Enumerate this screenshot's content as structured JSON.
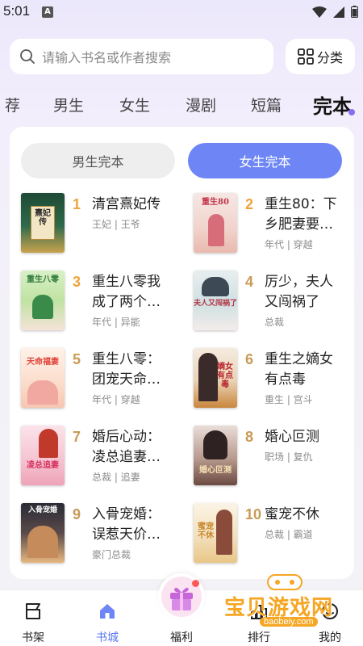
{
  "status_bar": {
    "time": "5:01",
    "badge": "A"
  },
  "search": {
    "placeholder": "请输入书名或作者搜索"
  },
  "category_button": {
    "label": "分类"
  },
  "tabs": [
    {
      "label": "荐"
    },
    {
      "label": "男生"
    },
    {
      "label": "女生"
    },
    {
      "label": "漫剧"
    },
    {
      "label": "短篇"
    },
    {
      "label": "完本",
      "active": true
    }
  ],
  "toggle": {
    "male_label": "男生完本",
    "female_label": "女生完本",
    "selected": "女生完本"
  },
  "books": [
    {
      "rank": "1",
      "title": "清宫熹妃传",
      "tags": "王妃 | 王爷",
      "cover_text": "熹妃传"
    },
    {
      "rank": "2",
      "title": "重生80：下乡肥妻要…",
      "tags": "年代 | 穿越",
      "cover_text": "重生80"
    },
    {
      "rank": "3",
      "title": "重生八零我成了两个…",
      "tags": "年代 | 异能",
      "cover_text": "重生八零"
    },
    {
      "rank": "4",
      "title": "厉少，夫人又闯祸了",
      "tags": "总裁",
      "cover_text": "夫人又闯祸了"
    },
    {
      "rank": "5",
      "title": "重生八零：团宠天命…",
      "tags": "年代 | 穿越",
      "cover_text": "天命福妻"
    },
    {
      "rank": "6",
      "title": "重生之嫡女有点毒",
      "tags": "重生 | 宫斗",
      "cover_text": "嫡女有点毒"
    },
    {
      "rank": "7",
      "title": "婚后心动：凌总追妻…",
      "tags": "总裁 | 追妻",
      "cover_text": "凌总追妻"
    },
    {
      "rank": "8",
      "title": "婚心叵测",
      "tags": "职场 | 复仇",
      "cover_text": "婚心叵测"
    },
    {
      "rank": "9",
      "title": "入骨宠婚：误惹天价…",
      "tags": "豪门总裁",
      "cover_text": "入骨宠婚"
    },
    {
      "rank": "10",
      "title": "蜜宠不休",
      "tags": "总裁 | 霸道",
      "cover_text": "蜜宠不休"
    }
  ],
  "bottom_nav": [
    {
      "label": "书架",
      "icon": "bookshelf-icon"
    },
    {
      "label": "书城",
      "icon": "home-icon",
      "active": true
    },
    {
      "label": "福利",
      "icon": "gift-icon"
    },
    {
      "label": "排行",
      "icon": "ranking-icon"
    },
    {
      "label": "我的",
      "icon": "profile-icon"
    }
  ],
  "watermark": {
    "text": "宝贝游戏网",
    "url": "baobeiy.com"
  },
  "colors": {
    "accent": "#6e86f5",
    "rank_color": "#c99a55",
    "tab_text": "#444444",
    "active_nav": "#5a78f0"
  }
}
